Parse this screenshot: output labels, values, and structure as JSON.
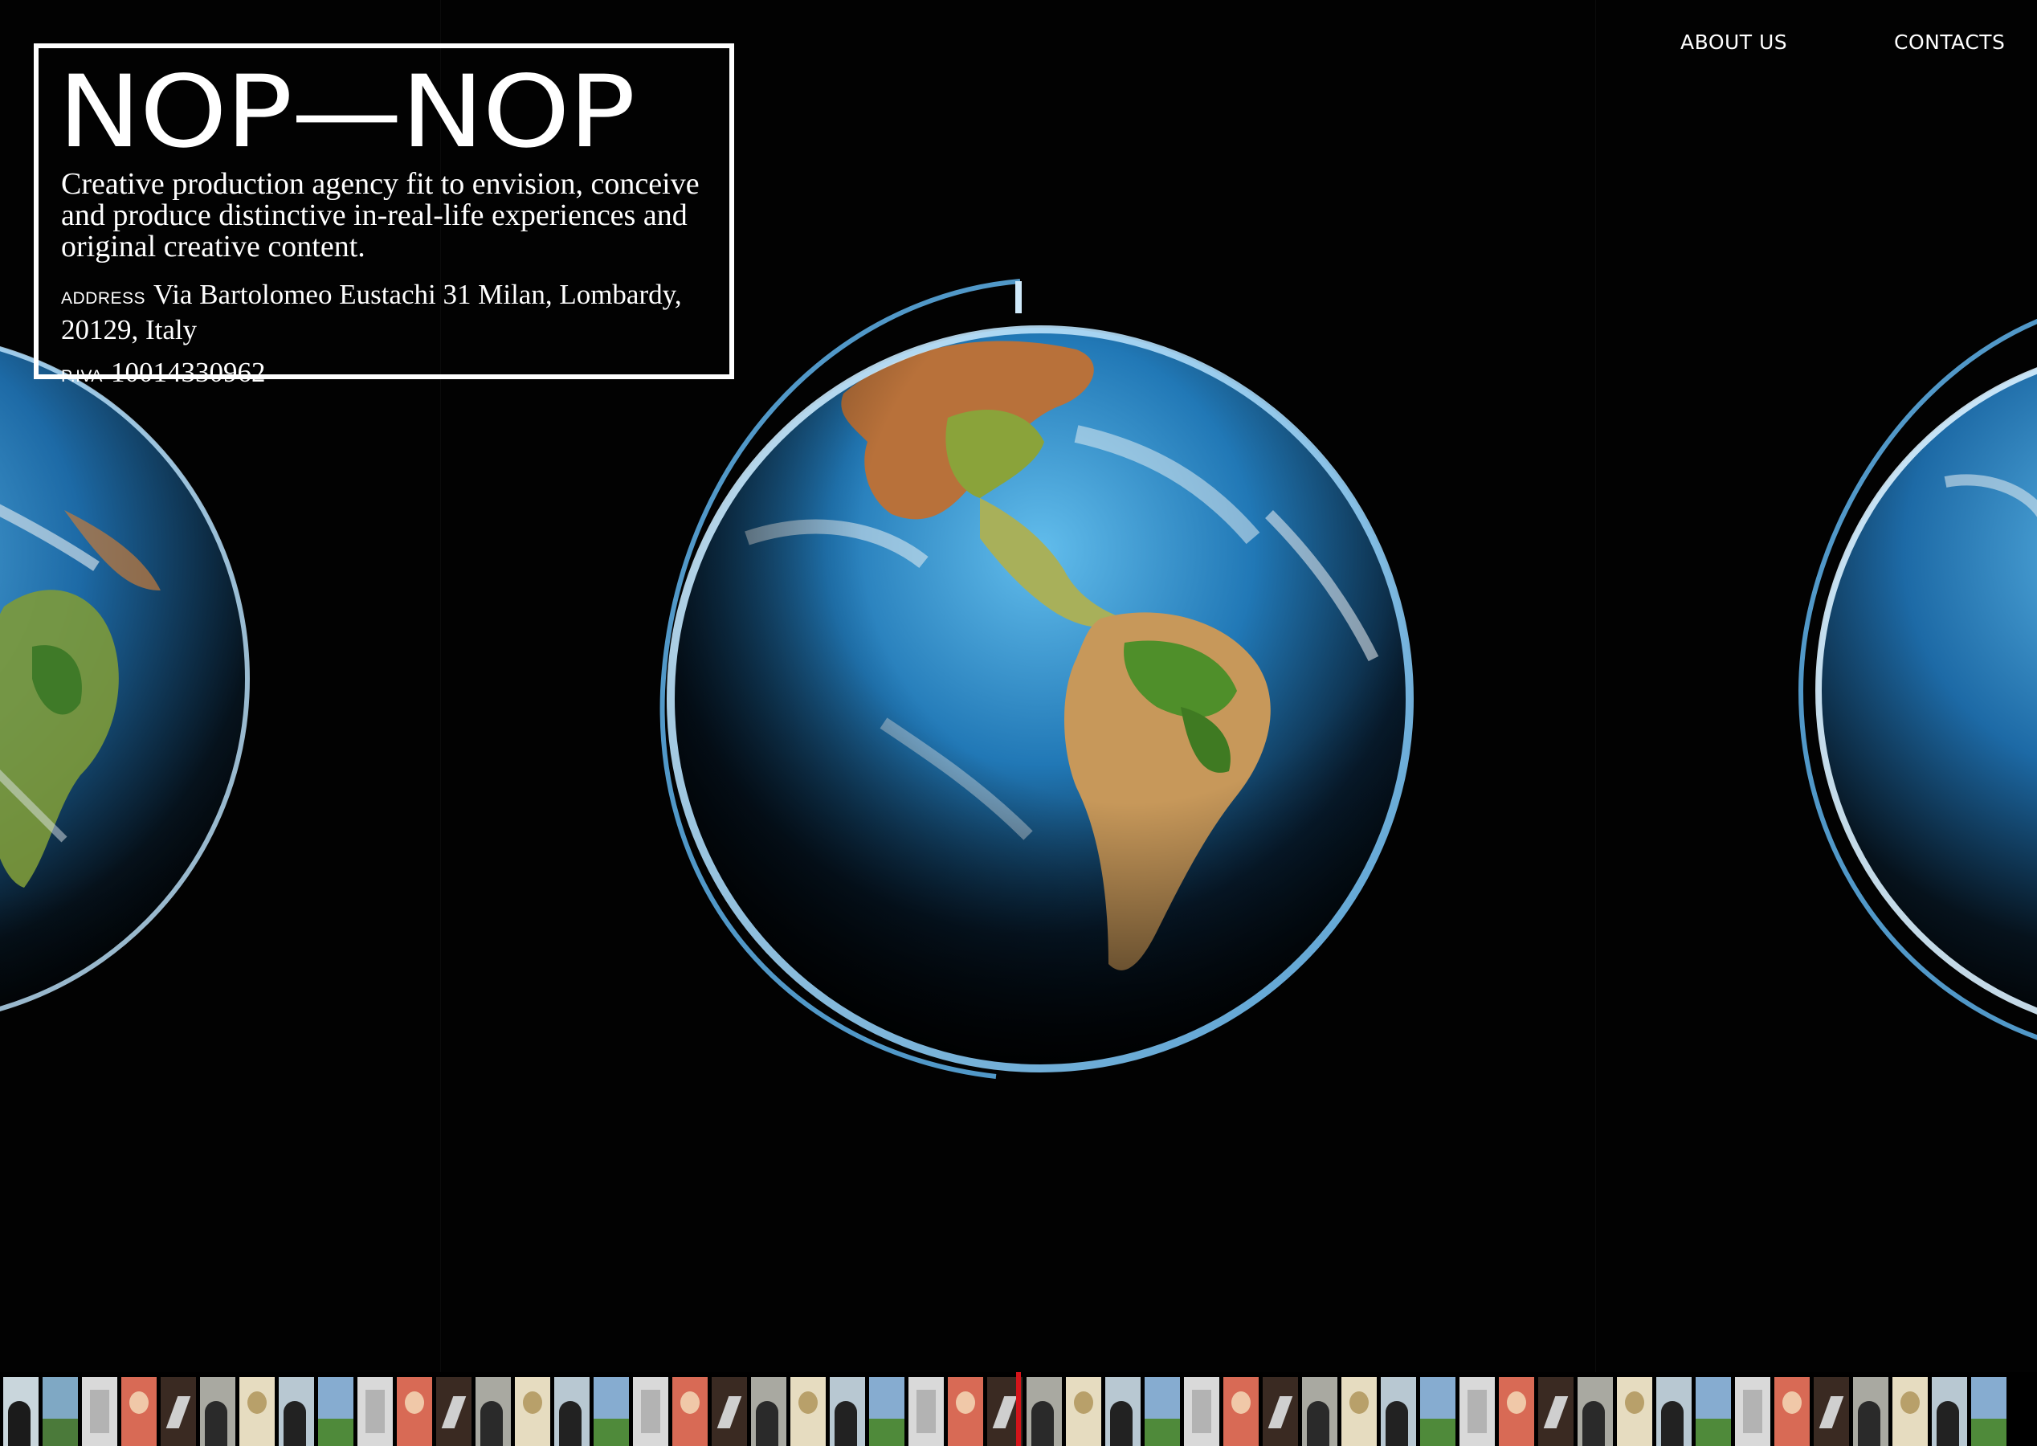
{
  "brand": {
    "logo": "NOP—NOP",
    "tagline": "Creative production agency fit to envision, conceive and produce distinctive in-real-life experiences and original creative content.",
    "address_label": "ADDRESS",
    "address_value": "Via Bartolomeo Eustachi 31 Milan, Lombardy, 20129, Italy",
    "piva_label": "P.IVA",
    "piva_value": "10014330962"
  },
  "nav": {
    "about": "ABOUT US",
    "contacts": "CONTACTS"
  },
  "colors": {
    "background": "#000000",
    "foreground": "#ffffff",
    "playhead": "#d4141a"
  },
  "strip": {
    "thumbnails": [
      {
        "bg": "#c9d6dc",
        "accent": "#1b1b1b",
        "kind": "figure"
      },
      {
        "bg": "#7fa8c4",
        "accent": "#4b7a3a",
        "kind": "field"
      },
      {
        "bg": "#d9d9d9",
        "accent": "#9a9a9a",
        "kind": "poster"
      },
      {
        "bg": "#d86a55",
        "accent": "#f0c8a8",
        "kind": "portrait"
      },
      {
        "bg": "#3a2a22",
        "accent": "#cfcfcf",
        "kind": "dark"
      },
      {
        "bg": "#a9a9a1",
        "accent": "#2a2a2a",
        "kind": "figure"
      },
      {
        "bg": "#e6dcc0",
        "accent": "#b8a06a",
        "kind": "portrait"
      },
      {
        "bg": "#b8c8d2",
        "accent": "#222222",
        "kind": "figure"
      },
      {
        "bg": "#86acd0",
        "accent": "#4f8a3a",
        "kind": "field"
      },
      {
        "bg": "#d9d9d9",
        "accent": "#9a9a9a",
        "kind": "poster"
      },
      {
        "bg": "#d86a55",
        "accent": "#f0c8a8",
        "kind": "portrait"
      },
      {
        "bg": "#3a2a22",
        "accent": "#cfcfcf",
        "kind": "dark"
      },
      {
        "bg": "#a9a9a1",
        "accent": "#2a2a2a",
        "kind": "figure"
      },
      {
        "bg": "#e6dcc0",
        "accent": "#b8a06a",
        "kind": "portrait"
      },
      {
        "bg": "#b8c8d2",
        "accent": "#222222",
        "kind": "figure"
      },
      {
        "bg": "#86acd0",
        "accent": "#4f8a3a",
        "kind": "field"
      },
      {
        "bg": "#d9d9d9",
        "accent": "#9a9a9a",
        "kind": "poster"
      },
      {
        "bg": "#d86a55",
        "accent": "#f0c8a8",
        "kind": "portrait"
      },
      {
        "bg": "#3a2a22",
        "accent": "#cfcfcf",
        "kind": "dark"
      },
      {
        "bg": "#a9a9a1",
        "accent": "#2a2a2a",
        "kind": "figure"
      },
      {
        "bg": "#e6dcc0",
        "accent": "#b8a06a",
        "kind": "portrait"
      },
      {
        "bg": "#b8c8d2",
        "accent": "#222222",
        "kind": "figure"
      },
      {
        "bg": "#86acd0",
        "accent": "#4f8a3a",
        "kind": "field"
      },
      {
        "bg": "#d9d9d9",
        "accent": "#9a9a9a",
        "kind": "poster"
      },
      {
        "bg": "#d86a55",
        "accent": "#f0c8a8",
        "kind": "portrait"
      },
      {
        "bg": "#3a2a22",
        "accent": "#cfcfcf",
        "kind": "dark"
      },
      {
        "bg": "#a9a9a1",
        "accent": "#2a2a2a",
        "kind": "figure"
      },
      {
        "bg": "#e6dcc0",
        "accent": "#b8a06a",
        "kind": "portrait"
      },
      {
        "bg": "#b8c8d2",
        "accent": "#222222",
        "kind": "figure"
      },
      {
        "bg": "#86acd0",
        "accent": "#4f8a3a",
        "kind": "field"
      },
      {
        "bg": "#d9d9d9",
        "accent": "#9a9a9a",
        "kind": "poster"
      },
      {
        "bg": "#d86a55",
        "accent": "#f0c8a8",
        "kind": "portrait"
      },
      {
        "bg": "#3a2a22",
        "accent": "#cfcfcf",
        "kind": "dark"
      },
      {
        "bg": "#a9a9a1",
        "accent": "#2a2a2a",
        "kind": "figure"
      },
      {
        "bg": "#e6dcc0",
        "accent": "#b8a06a",
        "kind": "portrait"
      },
      {
        "bg": "#b8c8d2",
        "accent": "#222222",
        "kind": "figure"
      },
      {
        "bg": "#86acd0",
        "accent": "#4f8a3a",
        "kind": "field"
      },
      {
        "bg": "#d9d9d9",
        "accent": "#9a9a9a",
        "kind": "poster"
      },
      {
        "bg": "#d86a55",
        "accent": "#f0c8a8",
        "kind": "portrait"
      },
      {
        "bg": "#3a2a22",
        "accent": "#cfcfcf",
        "kind": "dark"
      },
      {
        "bg": "#a9a9a1",
        "accent": "#2a2a2a",
        "kind": "figure"
      },
      {
        "bg": "#e6dcc0",
        "accent": "#b8a06a",
        "kind": "portrait"
      },
      {
        "bg": "#b8c8d2",
        "accent": "#222222",
        "kind": "figure"
      },
      {
        "bg": "#86acd0",
        "accent": "#4f8a3a",
        "kind": "field"
      },
      {
        "bg": "#d9d9d9",
        "accent": "#9a9a9a",
        "kind": "poster"
      },
      {
        "bg": "#d86a55",
        "accent": "#f0c8a8",
        "kind": "portrait"
      },
      {
        "bg": "#3a2a22",
        "accent": "#cfcfcf",
        "kind": "dark"
      },
      {
        "bg": "#a9a9a1",
        "accent": "#2a2a2a",
        "kind": "figure"
      },
      {
        "bg": "#e6dcc0",
        "accent": "#b8a06a",
        "kind": "portrait"
      },
      {
        "bg": "#b8c8d2",
        "accent": "#222222",
        "kind": "figure"
      },
      {
        "bg": "#86acd0",
        "accent": "#4f8a3a",
        "kind": "field"
      }
    ]
  }
}
